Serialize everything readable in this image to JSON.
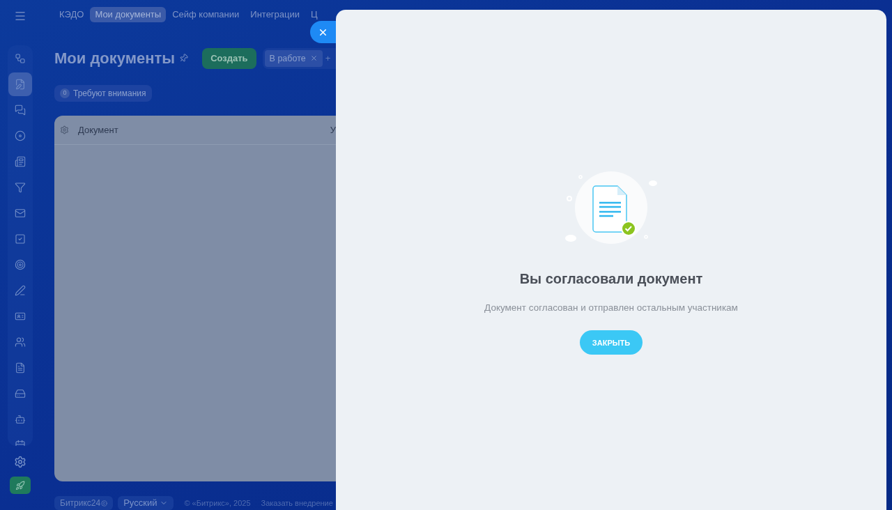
{
  "top_nav": [
    {
      "label": "КЭДО",
      "selected": false
    },
    {
      "label": "Мои документы",
      "selected": true
    },
    {
      "label": "Сейф компании",
      "selected": false
    },
    {
      "label": "Интеграции",
      "selected": false
    },
    {
      "label": "Ц",
      "selected": false
    }
  ],
  "sidebar": {
    "items": [
      {
        "selected": false
      },
      {
        "selected": true
      },
      {
        "selected": false
      },
      {
        "selected": false
      },
      {
        "selected": false
      },
      {
        "selected": false
      },
      {
        "selected": false
      },
      {
        "selected": false
      },
      {
        "selected": false
      },
      {
        "selected": false
      },
      {
        "selected": false
      },
      {
        "selected": false
      },
      {
        "selected": false
      },
      {
        "selected": false
      },
      {
        "selected": false
      },
      {
        "selected": false
      }
    ]
  },
  "page": {
    "title": "Мои документы",
    "create_button": "Создать",
    "filter_chip": "В работе",
    "filter_add": "+",
    "attention": {
      "count": "0",
      "label": "Требуют внимания"
    }
  },
  "table": {
    "columns": [
      "Документ",
      "У"
    ]
  },
  "footer": {
    "brand": "Битрикс24",
    "language": "Русский",
    "copyright": "© «Битрикс», 2025",
    "link": "Заказать внедрение"
  },
  "slider": {
    "title": "Вы согласовали документ",
    "message": "Документ согласован и отправлен остальным участникам",
    "button": "ЗАКРЫТЬ"
  }
}
